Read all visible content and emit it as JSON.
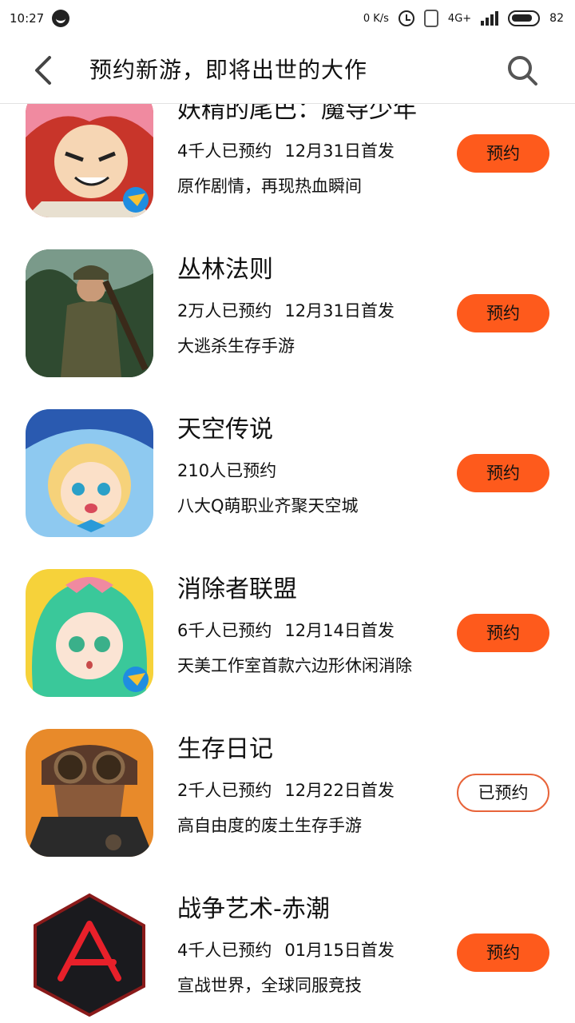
{
  "status_bar": {
    "time": "10:27",
    "net_speed": "0 K/s",
    "network": "4G+",
    "battery": "82"
  },
  "header": {
    "title": "预约新游，即将出世的大作"
  },
  "games": [
    {
      "name": "妖精的尾巴：魔导少年",
      "count": "4千人已预约",
      "date": "12月31日首发",
      "desc": "原作剧情，再现热血瞬间",
      "button": "预约",
      "booked": false
    },
    {
      "name": "丛林法则",
      "count": "2万人已预约",
      "date": "12月31日首发",
      "desc": "大逃杀生存手游",
      "button": "预约",
      "booked": false
    },
    {
      "name": "天空传说",
      "count": "210人已预约",
      "date": "",
      "desc": "八大Q萌职业齐聚天空城",
      "button": "预约",
      "booked": false
    },
    {
      "name": "消除者联盟",
      "count": "6千人已预约",
      "date": "12月14日首发",
      "desc": "天美工作室首款六边形休闲消除",
      "button": "预约",
      "booked": false
    },
    {
      "name": "生存日记",
      "count": "2千人已预约",
      "date": "12月22日首发",
      "desc": "高自由度的废土生存手游",
      "button": "已预约",
      "booked": true
    },
    {
      "name": "战争艺术-赤潮",
      "count": "4千人已预约",
      "date": "01月15日首发",
      "desc": "宣战世界，全球同服竞技",
      "button": "预约",
      "booked": false
    }
  ],
  "colors": {
    "accent": "#fe5a1c",
    "divider": "#e2e2e2"
  }
}
